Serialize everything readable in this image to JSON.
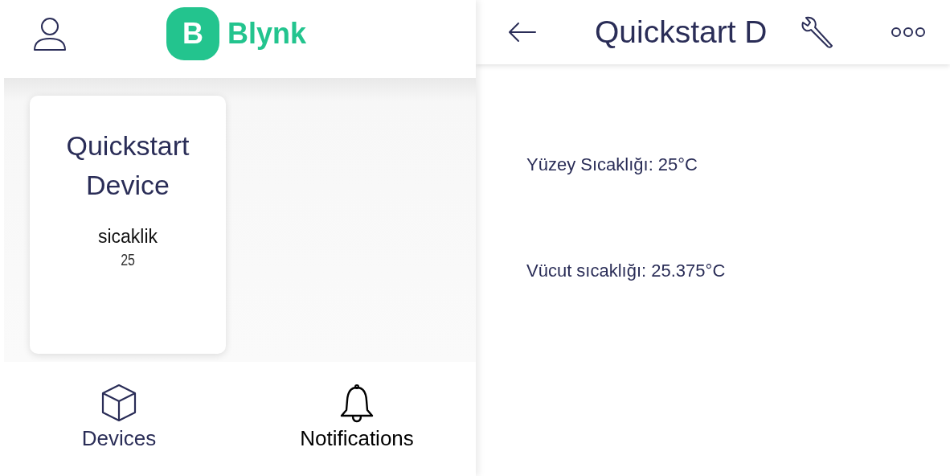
{
  "left_screen": {
    "header": {
      "logo": {
        "mark": "B",
        "name": "Blynk"
      }
    },
    "devices": [
      {
        "name": "Quickstart Device",
        "datastream": {
          "label": "sicaklik",
          "value": "25"
        }
      }
    ],
    "bottom_nav": [
      {
        "label": "Devices",
        "kind": "devices",
        "selected": true
      },
      {
        "label": "Notifications",
        "kind": "notifications",
        "selected": false
      }
    ]
  },
  "right_screen": {
    "header": {
      "title": "Quickstart D"
    },
    "readings": [
      "Yüzey Sıcaklığı: 25°C",
      "Vücut sıcaklığı: 25.375°C"
    ]
  }
}
